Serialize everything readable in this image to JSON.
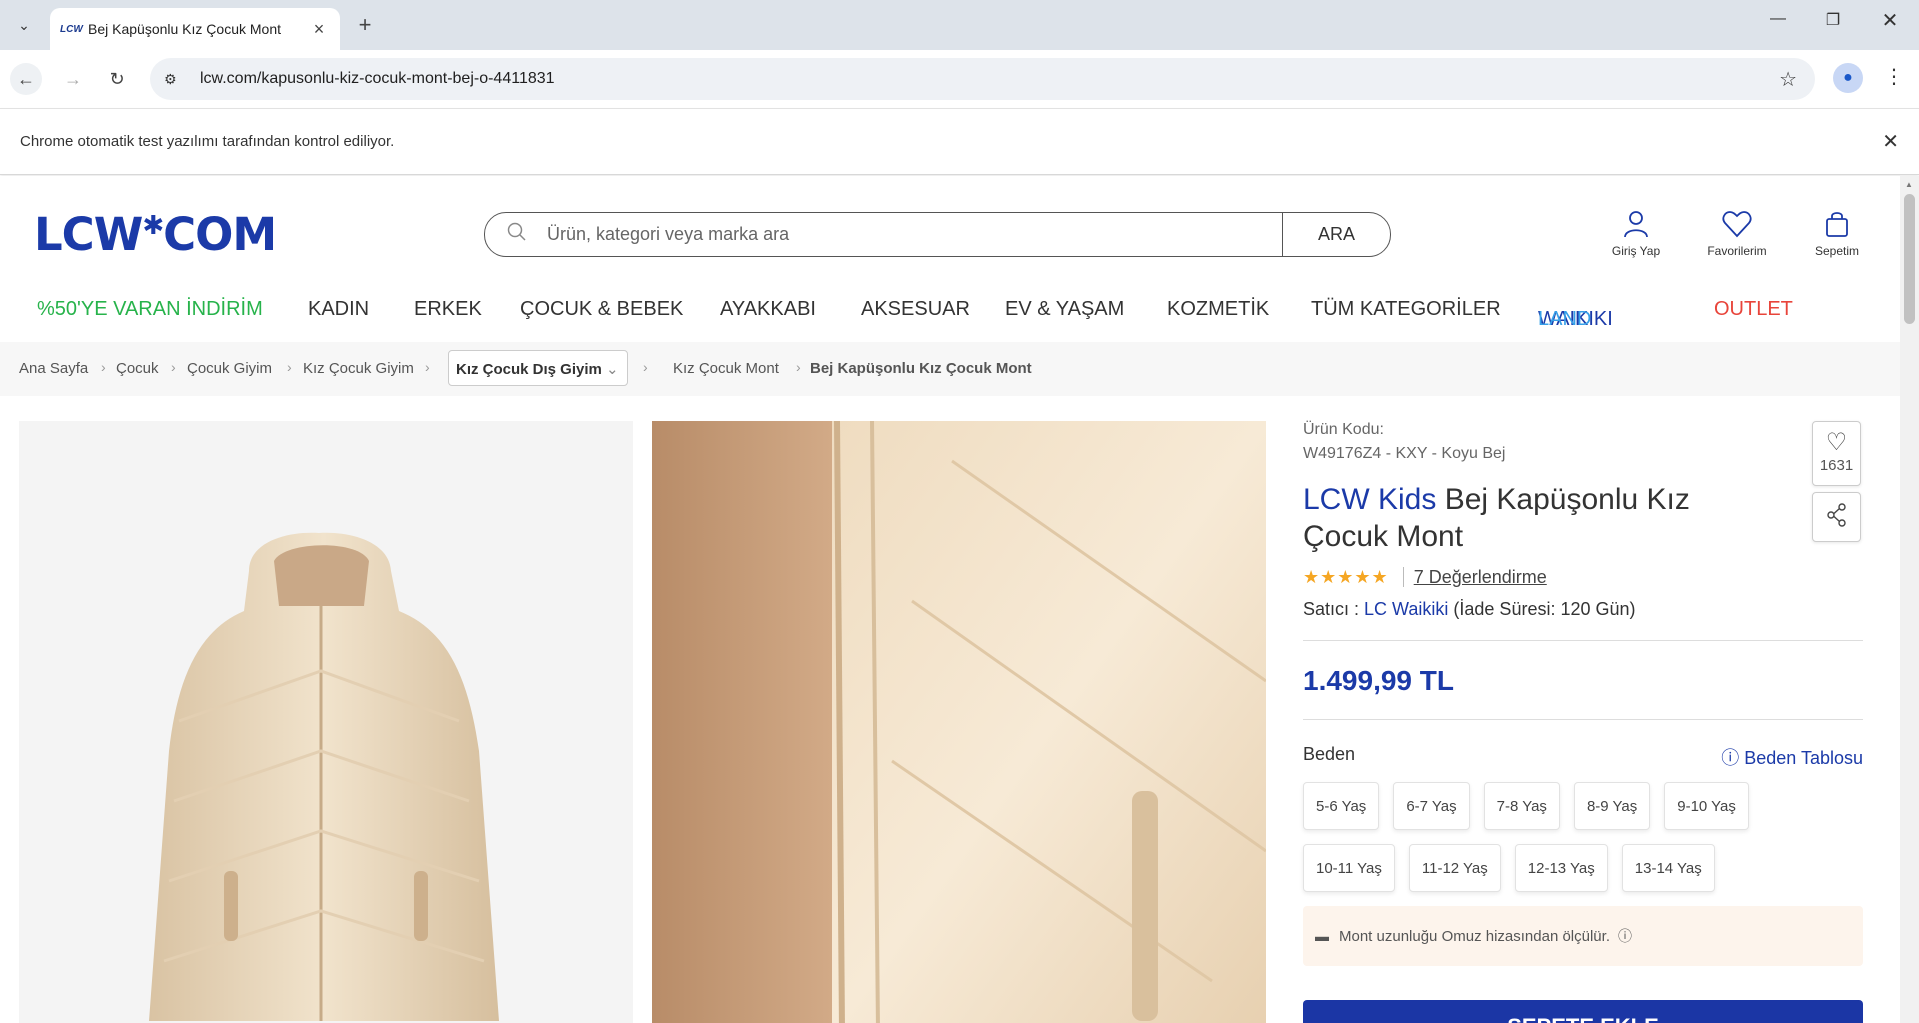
{
  "browser": {
    "tab_title": "Bej Kapüşonlu Kız Çocuk Mont",
    "tab_favicon": "LCW",
    "url": "lcw.com/kapusonlu-kiz-cocuk-mont-bej-o-4411831",
    "infobar_text": "Chrome otomatik test yazılımı tarafından kontrol ediliyor."
  },
  "header": {
    "logo": "LCW",
    "logo_star": "✱",
    "logo_suffix": "COM",
    "search_placeholder": "Ürün, kategori veya marka ara",
    "search_button": "ARA",
    "actions": {
      "login": "Giriş Yap",
      "favorites": "Favorilerim",
      "cart": "Sepetim"
    }
  },
  "nav": {
    "items": [
      {
        "label": "%50'YE VARAN İNDİRİM",
        "color": "#27b34b"
      },
      {
        "label": "KADIN"
      },
      {
        "label": "ERKEK"
      },
      {
        "label": "ÇOCUK & BEBEK"
      },
      {
        "label": "AYAKKABI"
      },
      {
        "label": "AKSESUAR"
      },
      {
        "label": "EV & YAŞAM"
      },
      {
        "label": "KOZMETİK"
      },
      {
        "label": "TÜM KATEGORİLER"
      }
    ],
    "waikiki_part1": "WAIKIKI",
    "waikiki_part2": "LAND",
    "outlet": "OUTLET"
  },
  "breadcrumb": {
    "items": [
      "Ana Sayfa",
      "Çocuk",
      "Çocuk Giyim",
      "Kız Çocuk Giyim"
    ],
    "dropdown": "Kız Çocuk Dış Giyim",
    "after": "Kız Çocuk Mont",
    "current": "Bej Kapüşonlu Kız Çocuk Mont"
  },
  "product": {
    "code_label": "Ürün Kodu:",
    "code_value": "W49176Z4 - KXY - Koyu Bej",
    "brand": "LCW Kids",
    "title": "Bej Kapüşonlu Kız Çocuk Mont",
    "stars": "★★★★★",
    "rating_value": 4.5,
    "reviews": "7 Değerlendirme",
    "seller_label": "Satıcı :",
    "seller_name": "LC Waikiki",
    "return_period": "(İade Süresi: 120 Gün)",
    "price": "1.499,99 TL",
    "size_label": "Beden",
    "size_table": "Beden Tablosu",
    "sizes": [
      "5-6 Yaş",
      "6-7 Yaş",
      "7-8 Yaş",
      "8-9 Yaş",
      "9-10 Yaş",
      "10-11 Yaş",
      "11-12 Yaş",
      "12-13 Yaş",
      "13-14 Yaş"
    ],
    "note": "Mont uzunluğu Omuz hizasından ölçülür.",
    "add_to_cart": "SEPETE EKLE",
    "favorite_count": "1631"
  },
  "colors": {
    "brand": "#1b3aa8",
    "discount": "#27b34b",
    "outlet": "#e8443a",
    "cart_button": "#1b36a5"
  }
}
